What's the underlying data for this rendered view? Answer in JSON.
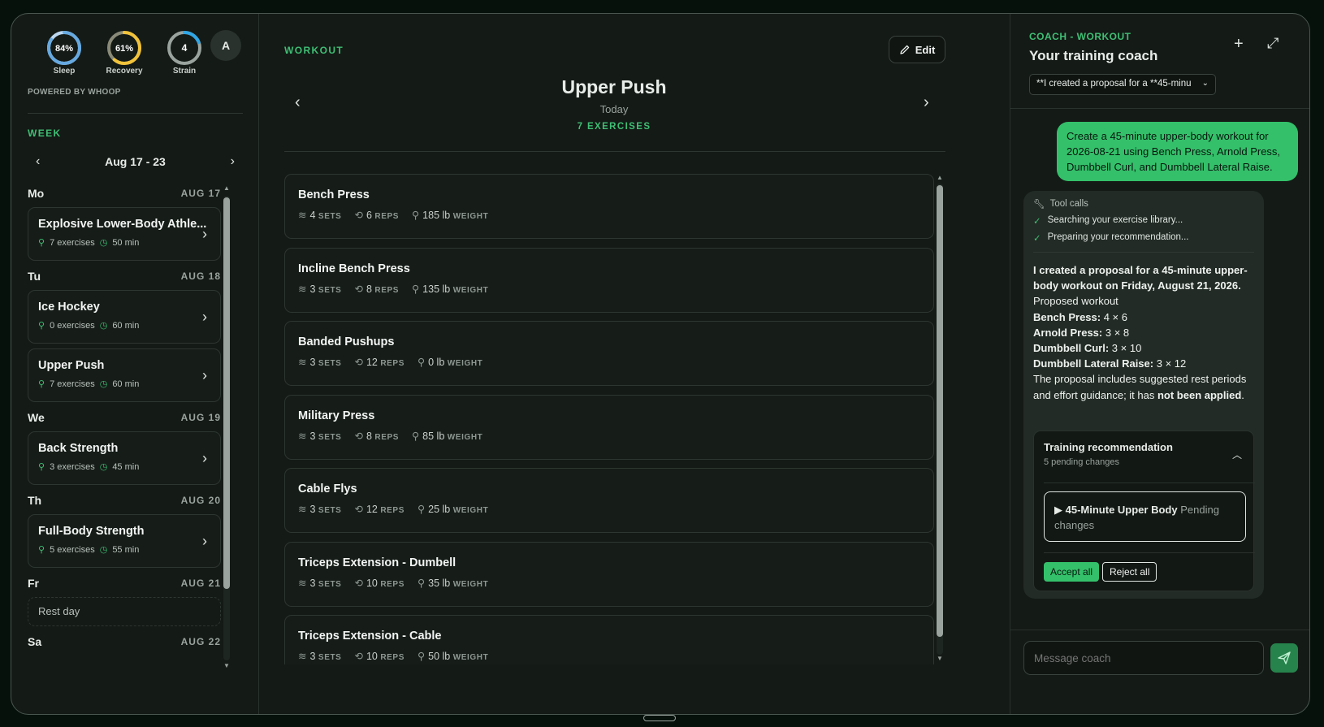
{
  "metrics": [
    {
      "value": "84%",
      "label": "Sleep",
      "level": 0.84,
      "color": "#66a9e0",
      "track": "#bcd7f0"
    },
    {
      "value": "61%",
      "label": "Recovery",
      "level": 0.61,
      "color": "#f2c33a",
      "track": "#8a8a78"
    },
    {
      "value": "4",
      "label": "Strain",
      "level": 0.19,
      "color": "#2fa6e6",
      "track": "#9aa39e"
    }
  ],
  "avatar": "A",
  "powered_by": "POWERED BY WHOOP",
  "week": {
    "label": "WEEK",
    "range": "Aug 17 - 23",
    "days": [
      {
        "name": "Mo",
        "date": "AUG 17",
        "items": [
          {
            "title": "Explosive Lower-Body Athle...",
            "exercises": "7 exercises",
            "duration": "50 min"
          }
        ]
      },
      {
        "name": "Tu",
        "date": "AUG 18",
        "items": [
          {
            "title": "Ice Hockey",
            "exercises": "0 exercises",
            "duration": "60 min"
          },
          {
            "title": "Upper Push",
            "exercises": "7 exercises",
            "duration": "60 min"
          }
        ]
      },
      {
        "name": "We",
        "date": "AUG 19",
        "items": [
          {
            "title": "Back Strength",
            "exercises": "3 exercises",
            "duration": "45 min"
          }
        ]
      },
      {
        "name": "Th",
        "date": "AUG 20",
        "items": [
          {
            "title": "Full-Body Strength",
            "exercises": "5 exercises",
            "duration": "55 min"
          }
        ]
      },
      {
        "name": "Fr",
        "date": "AUG 21",
        "rest": "Rest day"
      },
      {
        "name": "Sa",
        "date": "AUG 22"
      }
    ]
  },
  "workout": {
    "label": "WORKOUT",
    "edit_label": "Edit",
    "title": "Upper Push",
    "subtitle": "Today",
    "count": "7 EXERCISES",
    "units": {
      "sets": "SETS",
      "reps": "REPS",
      "weight": "WEIGHT"
    },
    "exercises": [
      {
        "name": "Bench Press",
        "sets": "4",
        "reps": "6",
        "weight": "185 lb"
      },
      {
        "name": "Incline Bench Press",
        "sets": "3",
        "reps": "8",
        "weight": "135 lb"
      },
      {
        "name": "Banded Pushups",
        "sets": "3",
        "reps": "12",
        "weight": "0 lb"
      },
      {
        "name": "Military Press",
        "sets": "3",
        "reps": "8",
        "weight": "85 lb"
      },
      {
        "name": "Cable Flys",
        "sets": "3",
        "reps": "12",
        "weight": "25 lb"
      },
      {
        "name": "Triceps Extension - Dumbell",
        "sets": "3",
        "reps": "10",
        "weight": "35 lb"
      },
      {
        "name": "Triceps Extension - Cable",
        "sets": "3",
        "reps": "10",
        "weight": "50 lb"
      }
    ]
  },
  "coach": {
    "label": "COACH - WORKOUT",
    "title": "Your training coach",
    "thread_select": "**I created a proposal for a **45-minu",
    "user_message": "Create a 45-minute upper-body workout for 2026-08-21 using Bench Press, Arnold Press, Dumbbell Curl, and Dumbbell Lateral Raise.",
    "tool_calls_label": "Tool calls",
    "tool_calls": [
      "Searching your exercise library...",
      "Preparing your recommendation..."
    ],
    "response": {
      "intro": "I created a proposal for a 45-minute upper-body workout on Friday, August 21, 2026.",
      "proposed": "Proposed workout",
      "lines": [
        {
          "name": "Bench Press:",
          "value": "4 × 6"
        },
        {
          "name": "Arnold Press:",
          "value": "3 × 8"
        },
        {
          "name": "Dumbbell Curl:",
          "value": "3 × 10"
        },
        {
          "name": "Dumbbell Lateral Raise:",
          "value": "3 × 12"
        }
      ],
      "outro_start": "The proposal includes suggested rest periods and effort guidance; it has ",
      "outro_bold": "not been applied",
      "outro_end": "."
    },
    "recommendation": {
      "title": "Training recommendation",
      "pending": "5 pending changes",
      "item_name": "45-Minute Upper Body",
      "item_status": "Pending changes",
      "accept": "Accept all",
      "reject": "Reject all"
    },
    "input_placeholder": "Message coach"
  }
}
